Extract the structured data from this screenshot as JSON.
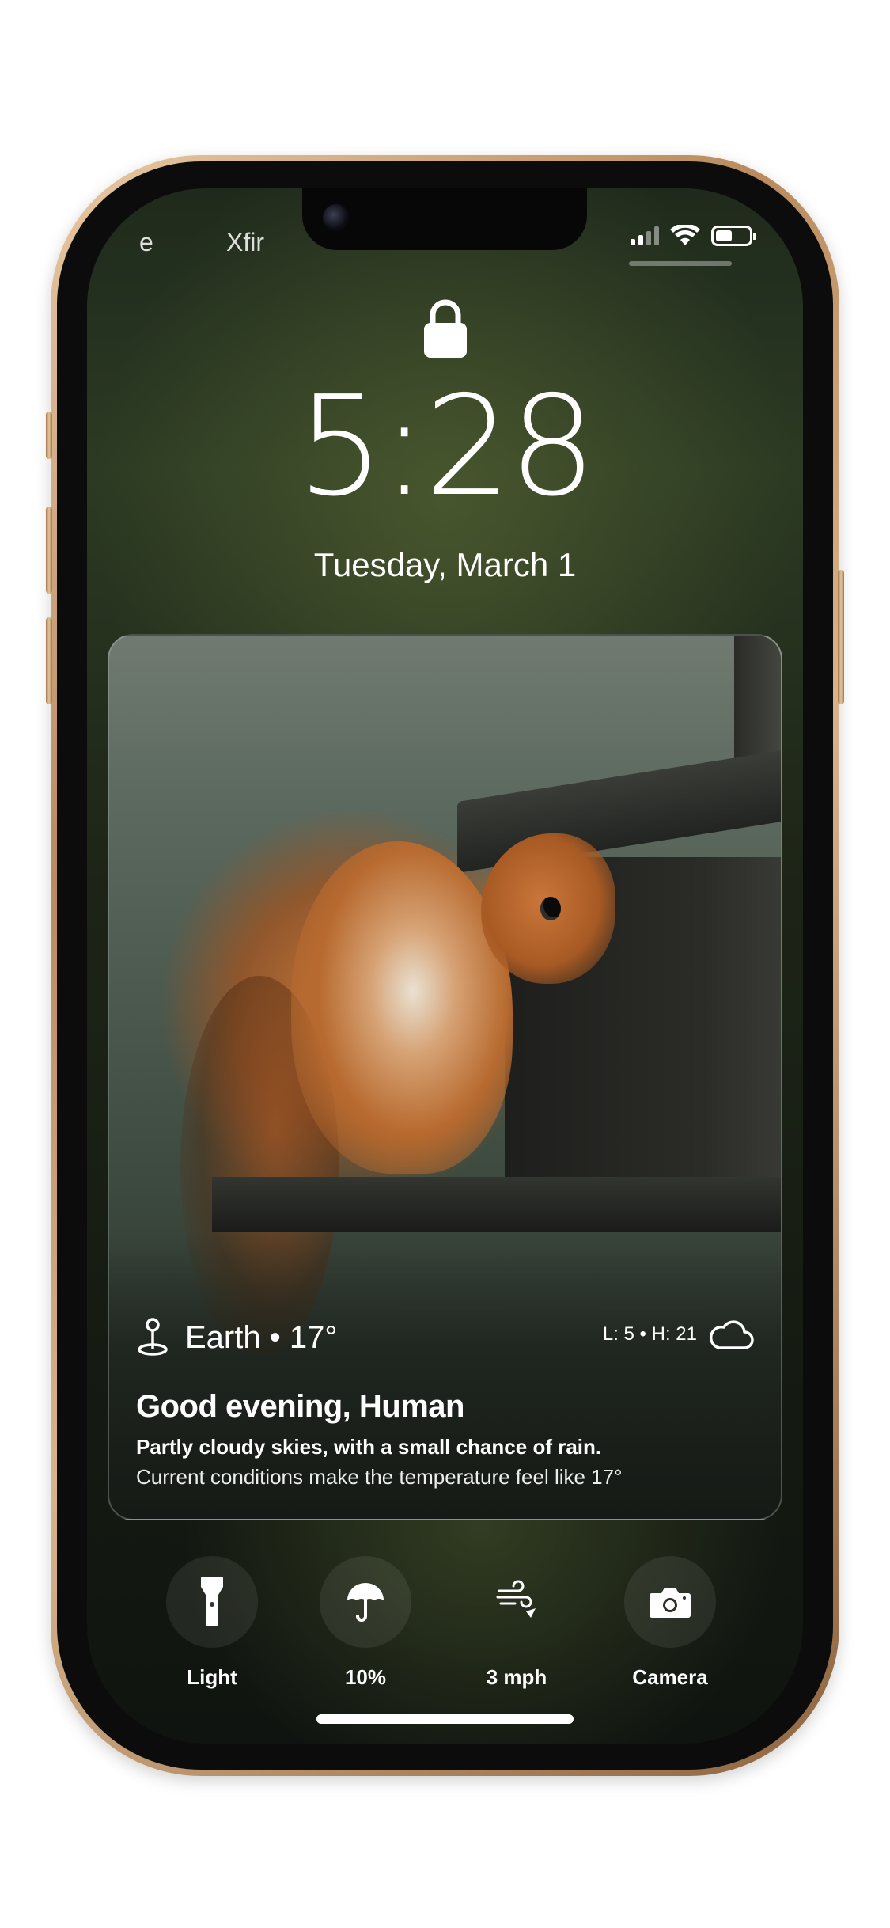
{
  "status_bar": {
    "carrier_left": "e",
    "carrier_right": "Xfir"
  },
  "lock_screen": {
    "time": "5:28",
    "date": "Tuesday, March 1"
  },
  "weather_widget": {
    "location": "Earth • 17°",
    "range": "L: 5 • H: 21",
    "greeting": "Good evening, Human",
    "forecast": "Partly cloudy skies, with a small chance of rain.",
    "conditions": "Current conditions make the temperature feel like 17°"
  },
  "quick_actions": [
    {
      "label": "Light",
      "icon": "flashlight-icon"
    },
    {
      "label": "10%",
      "icon": "umbrella-icon"
    },
    {
      "label": "3 mph",
      "icon": "wind-icon"
    },
    {
      "label": "Camera",
      "icon": "camera-icon"
    }
  ],
  "colors": {
    "frame_gold": "#c9a072",
    "screen_dark": "#1d2417",
    "text": "#ffffff"
  }
}
